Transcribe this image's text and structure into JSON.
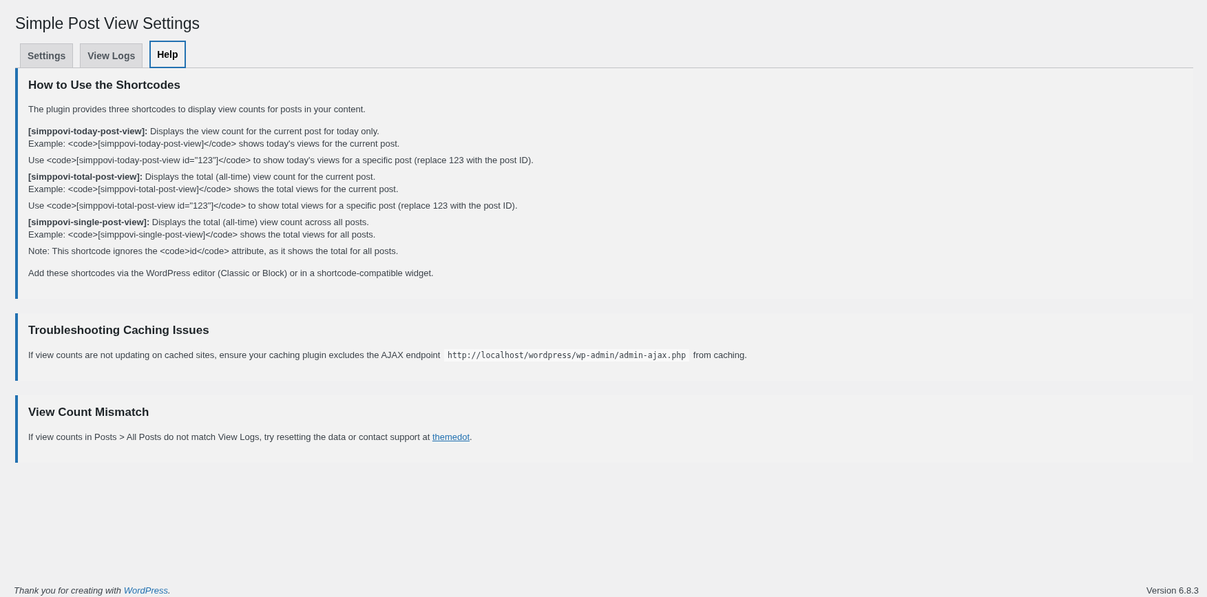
{
  "page": {
    "title": "Simple Post View Settings"
  },
  "tabs": [
    {
      "label": "Settings",
      "selected": false
    },
    {
      "label": "View Logs",
      "selected": false
    },
    {
      "label": "Help",
      "selected": true
    }
  ],
  "sections": [
    {
      "heading": "How to Use the Shortcodes",
      "intro": "The plugin provides three shortcodes to display view counts for posts in your content.",
      "items": [
        {
          "lines": [
            "**[simppovi-today-post-view]:** Displays the view count for the current post for today only.",
            "Example: <code>[simppovi-today-post-view]</code> shows today's views for the current post."
          ]
        },
        {
          "lines": [
            "Use <code>[simppovi-today-post-view id=\"123\"]</code> to show today's views for a specific post (replace 123 with the post ID)."
          ]
        },
        {
          "lines": [
            "**[simppovi-total-post-view]:** Displays the total (all-time) view count for the current post.",
            "Example: <code>[simppovi-total-post-view]</code> shows the total views for the current post."
          ]
        },
        {
          "lines": [
            "Use <code>[simppovi-total-post-view id=\"123\"]</code> to show total views for a specific post (replace 123 with the post ID)."
          ]
        },
        {
          "lines": [
            "**[simppovi-single-post-view]:** Displays the total (all-time) view count across all posts.",
            "Example: <code>[simppovi-single-post-view]</code> shows the total views for all posts."
          ]
        },
        {
          "lines": [
            "Note: This shortcode ignores the <code>id</code> attribute, as it shows the total for all posts."
          ]
        }
      ],
      "outro": "Add these shortcodes via the WordPress editor (Classic or Block) or in a shortcode-compatible widget."
    },
    {
      "heading": "Troubleshooting Caching Issues",
      "body": [
        {
          "kind": "text",
          "text": "If view counts are not updating on cached sites, ensure your caching plugin excludes the AJAX endpoint "
        },
        {
          "kind": "code",
          "text": "http://localhost/wordpress/wp-admin/admin-ajax.php"
        },
        {
          "kind": "text",
          "text": " from caching."
        }
      ]
    },
    {
      "heading": "View Count Mismatch",
      "body": [
        {
          "kind": "text",
          "text": "If view counts in Posts > All Posts do not match View Logs, try resetting the data or contact support at "
        },
        {
          "kind": "link",
          "text": "themedot"
        },
        {
          "kind": "text",
          "text": "."
        }
      ]
    }
  ],
  "footer": {
    "credit": [
      {
        "kind": "text",
        "text": "Thank you for creating with "
      },
      {
        "kind": "link",
        "text": "WordPress"
      },
      {
        "kind": "text",
        "text": "."
      }
    ],
    "version": "Version 6.8.3"
  }
}
